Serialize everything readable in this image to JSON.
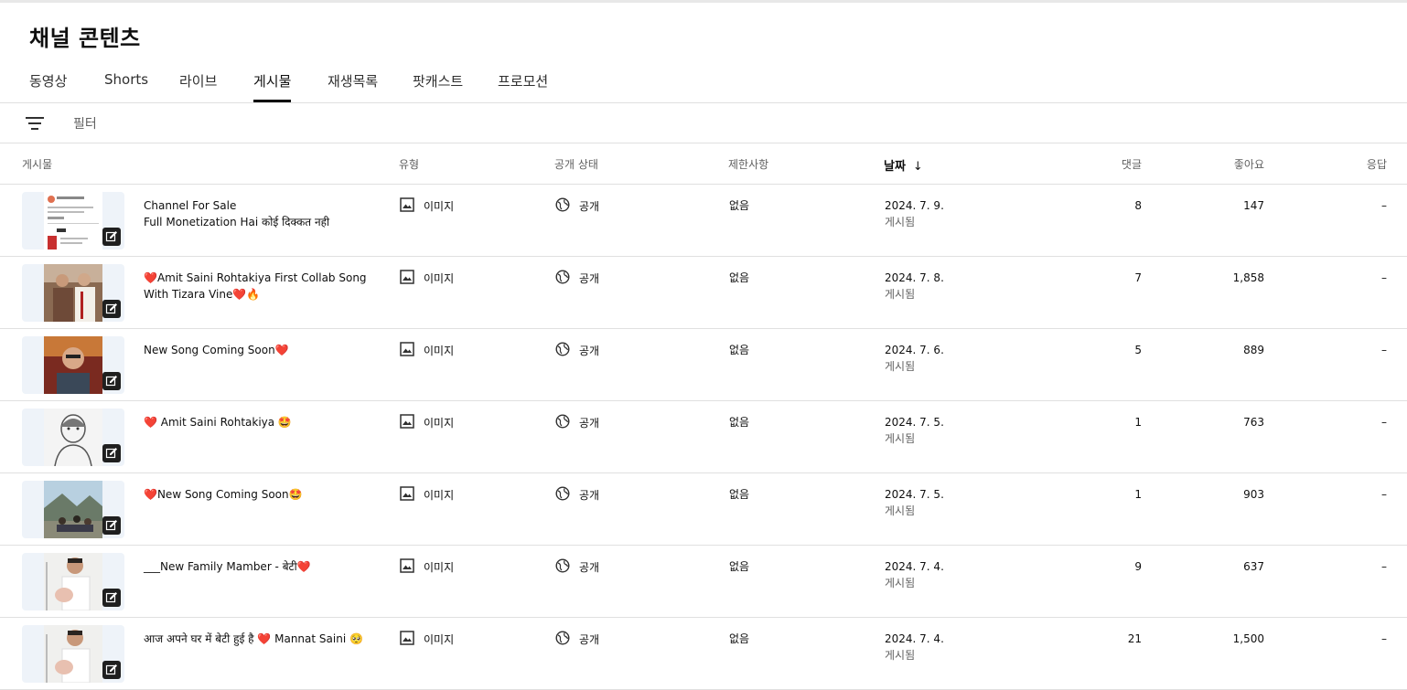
{
  "page_title": "채널 콘텐츠",
  "tabs": [
    {
      "label": "동영상",
      "active": false
    },
    {
      "label": "Shorts",
      "active": false
    },
    {
      "label": "라이브",
      "active": false
    },
    {
      "label": "게시물",
      "active": true
    },
    {
      "label": "재생목록",
      "active": false
    },
    {
      "label": "팟캐스트",
      "active": false
    },
    {
      "label": "프로모션",
      "active": false
    }
  ],
  "filter": {
    "label": "필터",
    "icon": "filter-icon"
  },
  "columns": {
    "post": "게시물",
    "type": "유형",
    "visibility": "공개 상태",
    "restrictions": "제한사항",
    "date": "날짜",
    "comments": "댓글",
    "likes": "좋아요",
    "responses": "응답"
  },
  "sort": {
    "column": "date",
    "direction": "descending",
    "icon": "arrow-down-icon"
  },
  "rows": [
    {
      "text_line1": "Channel For Sale",
      "text_line2": "Full Monetization Hai कोई दिक्कत नही",
      "type": "이미지",
      "visibility": "공개",
      "restrictions": "없음",
      "date": "2024. 7. 9.",
      "status": "게시됨",
      "comments": "8",
      "likes": "147",
      "responses": "–",
      "thumb": "screenshot"
    },
    {
      "text_line1": "❤️Amit Saini Rohtakiya First Collab Song",
      "text_line2": "With Tizara Vine❤️🔥",
      "type": "이미지",
      "visibility": "공개",
      "restrictions": "없음",
      "date": "2024. 7. 8.",
      "status": "게시됨",
      "comments": "7",
      "likes": "1,858",
      "responses": "–",
      "thumb": "two-men"
    },
    {
      "text_line1": "New Song Coming Soon❤️",
      "text_line2": "",
      "type": "이미지",
      "visibility": "공개",
      "restrictions": "없음",
      "date": "2024. 7. 6.",
      "status": "게시됨",
      "comments": "5",
      "likes": "889",
      "responses": "–",
      "thumb": "man-portrait"
    },
    {
      "text_line1": "❤️ Amit Saini Rohtakiya 🤩",
      "text_line2": "",
      "type": "이미지",
      "visibility": "공개",
      "restrictions": "없음",
      "date": "2024. 7. 5.",
      "status": "게시됨",
      "comments": "1",
      "likes": "763",
      "responses": "–",
      "thumb": "sketch"
    },
    {
      "text_line1": "❤️New Song Coming Soon🤩",
      "text_line2": "",
      "type": "이미지",
      "visibility": "공개",
      "restrictions": "없음",
      "date": "2024. 7. 5.",
      "status": "게시됨",
      "comments": "1",
      "likes": "903",
      "responses": "–",
      "thumb": "landscape"
    },
    {
      "text_line1": "___New Family Mamber - बेटी❤️",
      "text_line2": "",
      "type": "이미지",
      "visibility": "공개",
      "restrictions": "없음",
      "date": "2024. 7. 4.",
      "status": "게시됨",
      "comments": "9",
      "likes": "637",
      "responses": "–",
      "thumb": "family"
    },
    {
      "text_line1": "आज अपने घर में बेटी हुई है ❤️ Mannat Saini 🥺",
      "text_line2": "",
      "type": "이미지",
      "visibility": "공개",
      "restrictions": "없음",
      "date": "2024. 7. 4.",
      "status": "게시됨",
      "comments": "21",
      "likes": "1,500",
      "responses": "–",
      "thumb": "family"
    }
  ],
  "icons": {
    "type": "image-icon",
    "visibility": "globe-icon",
    "edit": "edit-icon"
  },
  "colors": {
    "heart": "#d61f26",
    "text": "#0f0f0f",
    "muted": "#606060",
    "divider": "#e0e0e0"
  }
}
